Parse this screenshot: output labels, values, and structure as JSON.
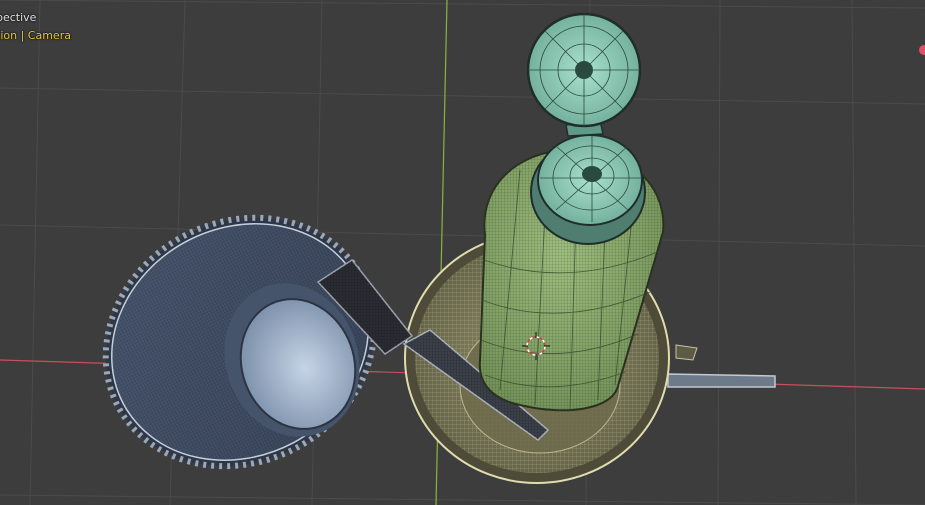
{
  "viewport": {
    "view_label": "User Perspective",
    "view_label_visible": "pective",
    "collection_label": "Collection",
    "collection_label_visible": "tion",
    "separator": "|",
    "object_label": "Camera"
  },
  "colors": {
    "background": "#3d3d3d",
    "grid": "#4a4a4a",
    "x_axis": "#c8505c",
    "y_axis": "#8cb43c",
    "bottle": "#8fb070",
    "caps": "#7fbfa8",
    "funnel_wire": "#b8b890",
    "cup_wire": "#8090a8",
    "collection_text": "#e8c83c"
  },
  "objects": [
    {
      "name": "bottle-body"
    },
    {
      "name": "bottle-cap-open"
    },
    {
      "name": "funnel-bowl"
    },
    {
      "name": "ribbed-cup"
    },
    {
      "name": "funnel-spout"
    },
    {
      "name": "knife"
    },
    {
      "name": "3d-cursor-icon"
    }
  ]
}
